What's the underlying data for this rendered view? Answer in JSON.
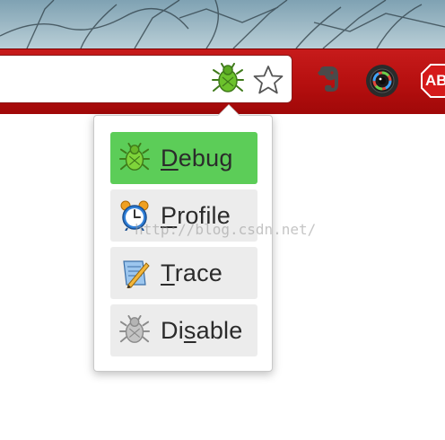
{
  "toolbar": {
    "address_bar_value": "",
    "extension_icon": "bug-icon",
    "bookmark_icon": "star-icon",
    "extensions": [
      "evernote-icon",
      "camera-icon",
      "adblock-icon"
    ],
    "adblock_label": "AB"
  },
  "popup": {
    "items": [
      {
        "label_prefix": "",
        "accel": "D",
        "label_rest": "ebug",
        "icon": "bug-icon",
        "active": true
      },
      {
        "label_prefix": "",
        "accel": "P",
        "label_rest": "rofile",
        "icon": "alarm-clock-icon",
        "active": false
      },
      {
        "label_prefix": "",
        "accel": "T",
        "label_rest": "race",
        "icon": "pencil-icon",
        "active": false
      },
      {
        "label_prefix": "Di",
        "accel": "s",
        "label_rest": "able",
        "icon": "disabled-bug-icon",
        "active": false
      }
    ]
  },
  "colors": {
    "toolbar_red": "#b50f0f",
    "active_green": "#5ccd58",
    "item_gray": "#ececec"
  },
  "watermark": "http://blog.csdn.net/"
}
